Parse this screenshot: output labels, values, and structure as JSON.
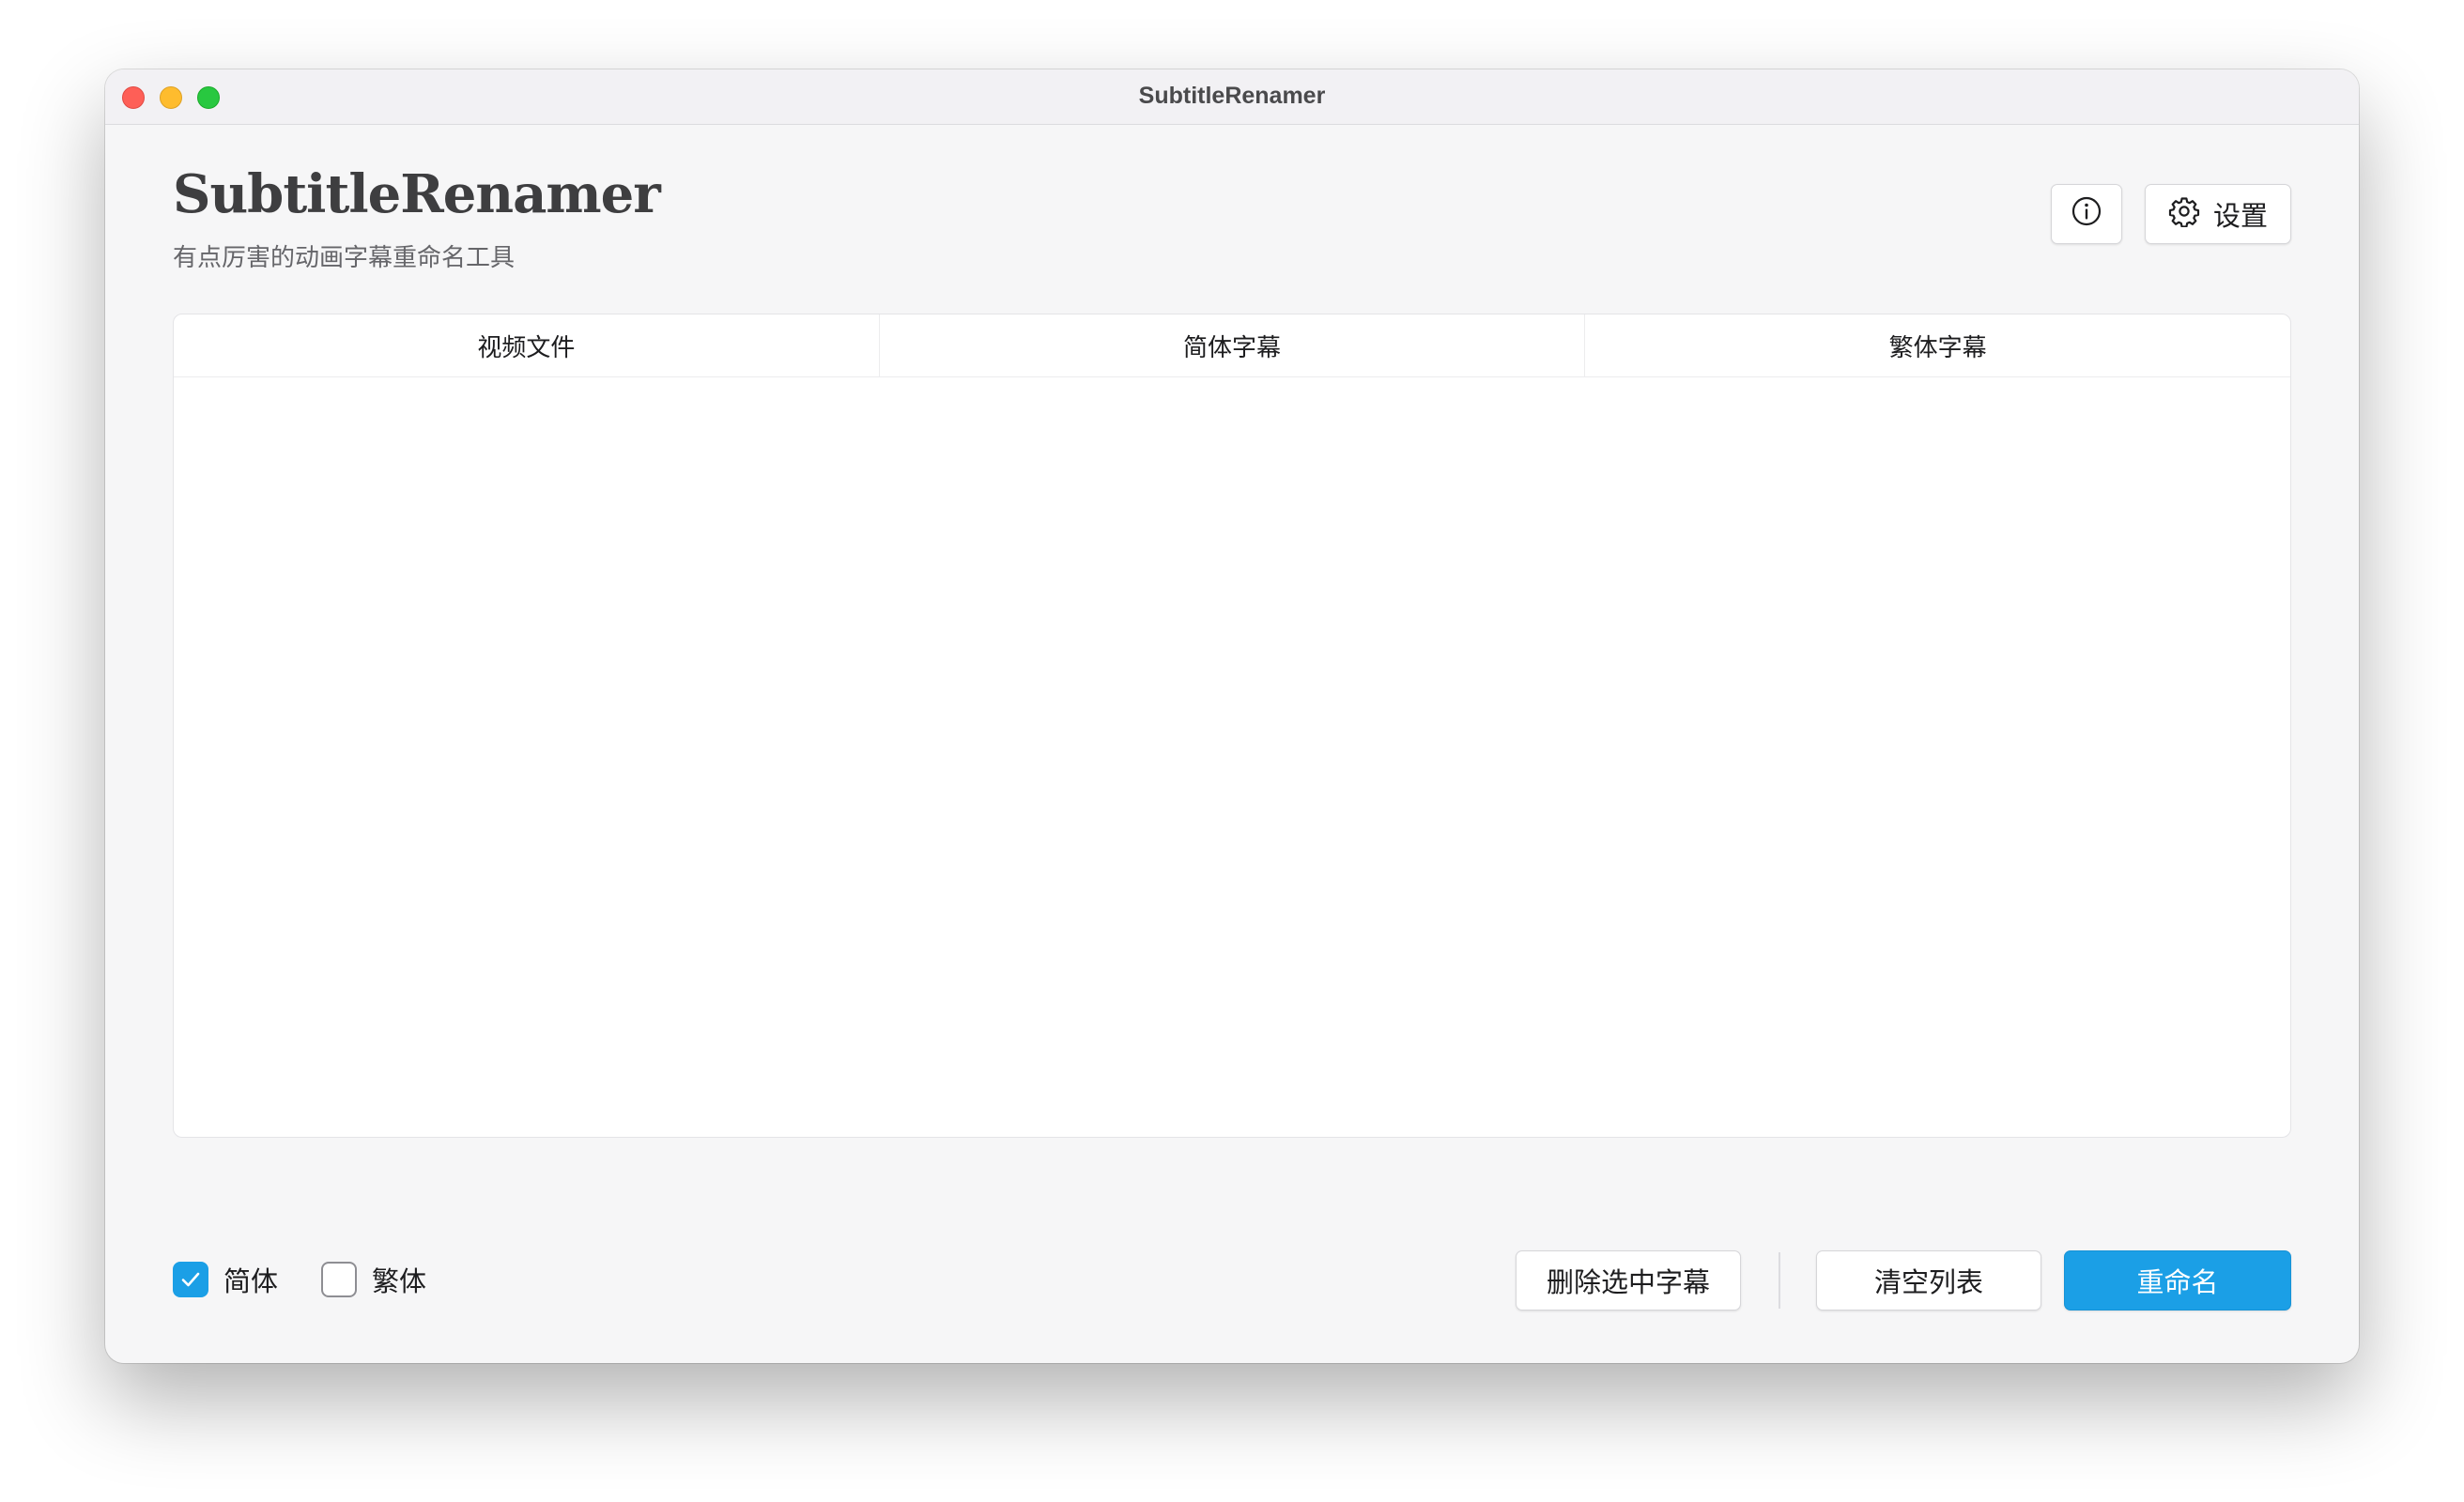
{
  "window": {
    "title": "SubtitleRenamer"
  },
  "header": {
    "app_title": "SubtitleRenamer",
    "subtitle": "有点厉害的动画字幕重命名工具",
    "settings_label": "设置",
    "info_icon": "info-circle-icon",
    "settings_icon": "gear-icon"
  },
  "table": {
    "columns": [
      "视频文件",
      "简体字幕",
      "繁体字幕"
    ],
    "rows": []
  },
  "footer": {
    "options": [
      {
        "label": "简体",
        "checked": true
      },
      {
        "label": "繁体",
        "checked": false
      }
    ],
    "delete_label": "删除选中字幕",
    "clear_label": "清空列表",
    "rename_label": "重命名"
  },
  "colors": {
    "accent": "#1b9fe6",
    "close": "#fe5f57",
    "minimize": "#febc2e",
    "maximize": "#28c840"
  }
}
